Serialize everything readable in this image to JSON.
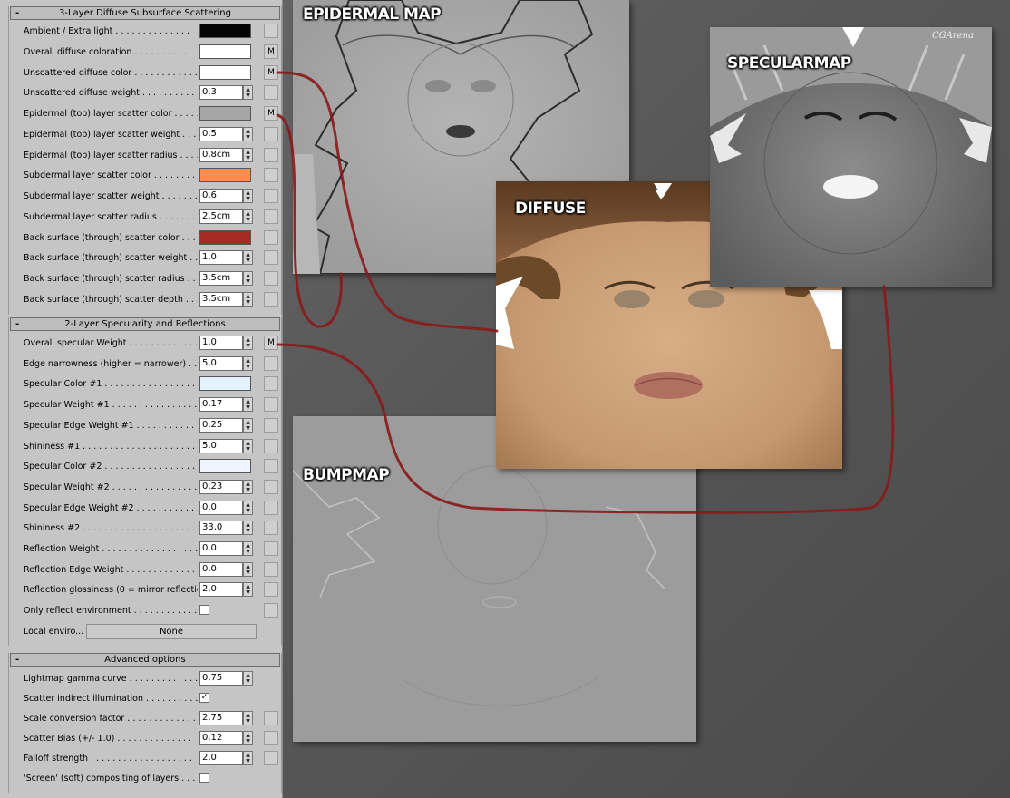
{
  "panel": {
    "section1": {
      "title": "3-Layer Diffuse Subsurface Scattering",
      "collapse": "-",
      "rows": [
        {
          "label": "Ambient / Extra light . . . . . . . . . . . . . .",
          "type": "color",
          "color": "#050505",
          "slot": ""
        },
        {
          "label": "Overall diffuse coloration . . . . . . . . . .",
          "type": "color",
          "color": "#ffffff",
          "slot": "M"
        },
        {
          "label": "Unscattered diffuse color . . . . . . . . . . . .",
          "type": "color",
          "color": "#ffffff",
          "slot": "M"
        },
        {
          "label": "Unscattered diffuse weight . . . . . . . . . . .",
          "type": "spinner",
          "value": "0,3",
          "slot": ""
        },
        {
          "label": "Epidermal (top) layer scatter color . . . . . .",
          "type": "color",
          "color": "#a6a6a6",
          "slot": "M"
        },
        {
          "label": "Epidermal (top) layer scatter weight . . . . .",
          "type": "spinner",
          "value": "0,5",
          "slot": ""
        },
        {
          "label": "Epidermal (top) layer scatter radius . . . . .",
          "type": "spinner",
          "value": "0,8cm",
          "slot": ""
        },
        {
          "label": "Subdermal layer scatter color . . . . . . . . .",
          "type": "color",
          "color": "#ff8f4e",
          "slot": ""
        },
        {
          "label": "Subdermal layer scatter weight . . . . . . . .",
          "type": "spinner",
          "value": "0,6",
          "slot": ""
        },
        {
          "label": "Subdermal layer scatter radius . . . . . . . .",
          "type": "spinner",
          "value": "2,5cm",
          "slot": ""
        },
        {
          "label": "Back surface (through) scatter color . . . . .",
          "type": "color",
          "color": "#a52a22",
          "slot": ""
        },
        {
          "label": "Back surface (through) scatter weight . . . .",
          "type": "spinner",
          "value": "1,0",
          "slot": ""
        },
        {
          "label": "Back surface (through) scatter radius . . . .",
          "type": "spinner",
          "value": "3,5cm",
          "slot": ""
        },
        {
          "label": "Back surface (through) scatter depth . . . .",
          "type": "spinner",
          "value": "3,5cm",
          "slot": ""
        }
      ]
    },
    "section2": {
      "title": "2-Layer Specularity and Reflections",
      "collapse": "-",
      "rows": [
        {
          "label": "Overall specular Weight . . . . . . . . . . . . .",
          "type": "spinner",
          "value": "1,0",
          "slot": "M"
        },
        {
          "label": "Edge narrowness (higher = narrower) . . .",
          "type": "spinner",
          "value": "5,0",
          "slot": ""
        },
        {
          "label": "Specular Color #1 . . . . . . . . . . . . . . . . .",
          "type": "color",
          "color": "#e4f1ff",
          "slot": ""
        },
        {
          "label": "Specular Weight #1 . . . . . . . . . . . . . . . .",
          "type": "spinner",
          "value": "0,17",
          "slot": ""
        },
        {
          "label": "Specular Edge Weight #1 . . . . . . . . . . . .",
          "type": "spinner",
          "value": "0,25",
          "slot": ""
        },
        {
          "label": "Shininess #1 . . . . . . . . . . . . . . . . . . . . .",
          "type": "spinner",
          "value": "5,0",
          "slot": ""
        },
        {
          "label": "Specular Color #2 . . . . . . . . . . . . . . . . .",
          "type": "color",
          "color": "#eef5ff",
          "slot": ""
        },
        {
          "label": "Specular Weight #2 . . . . . . . . . . . . . . . .",
          "type": "spinner",
          "value": "0,23",
          "slot": ""
        },
        {
          "label": "Specular Edge Weight #2 . . . . . . . . . . . .",
          "type": "spinner",
          "value": "0,0",
          "slot": ""
        },
        {
          "label": "Shininess #2 . . . . . . . . . . . . . . . . . . . . .",
          "type": "spinner",
          "value": "33,0",
          "slot": ""
        },
        {
          "label": "Reflection Weight . . . . . . . . . . . . . . . . . .",
          "type": "spinner",
          "value": "0,0",
          "slot": ""
        },
        {
          "label": "Reflection Edge Weight . . . . . . . . . . . . . .",
          "type": "spinner",
          "value": "0,0",
          "slot": ""
        },
        {
          "label": "Reflection glossiness (0 = mirror reflection)",
          "type": "spinner",
          "value": "2,0",
          "slot": ""
        },
        {
          "label": "Only reflect environment . . . . . . . . . . . .",
          "type": "checkbox",
          "checked": "",
          "slot": ""
        }
      ],
      "local_enviro_label": "Local enviro...",
      "local_enviro_button": "None"
    },
    "section3": {
      "title": "Advanced options",
      "collapse": "-",
      "rows": [
        {
          "label": "Lightmap gamma curve . . . . . . . . . . . . . .",
          "type": "spinner",
          "value": "0,75",
          "slot": "none"
        },
        {
          "label": "Scatter indirect illumination . . . . . . . . . . .",
          "type": "checkbox",
          "checked": "✓",
          "slot": "none"
        },
        {
          "label": "Scale conversion factor . . . . . . . . . . . . .",
          "type": "spinner",
          "value": "2,75",
          "slot": ""
        },
        {
          "label": "Scatter Bias (+/- 1.0) . . . . . . . . . . . . . .",
          "type": "spinner",
          "value": "0,12",
          "slot": ""
        },
        {
          "label": "Falloff strength . . . . . . . . . . . . . . . . . . .",
          "type": "spinner",
          "value": "2,0",
          "slot": ""
        },
        {
          "label": "'Screen' (soft) compositing of layers . . . . .",
          "type": "checkbox",
          "checked": "",
          "slot": "none"
        }
      ]
    }
  },
  "maps": {
    "epidermal": {
      "title": "EPIDERMAL MAP"
    },
    "bump": {
      "title": "BUMPMAP"
    },
    "diffuse": {
      "title": "DIFFUSE"
    },
    "specular": {
      "title": "SPECULARMAP",
      "watermark": "CGArena"
    }
  },
  "colors": {
    "connector": "#8b1a1a",
    "panel_bg": "#c5c5c5"
  }
}
